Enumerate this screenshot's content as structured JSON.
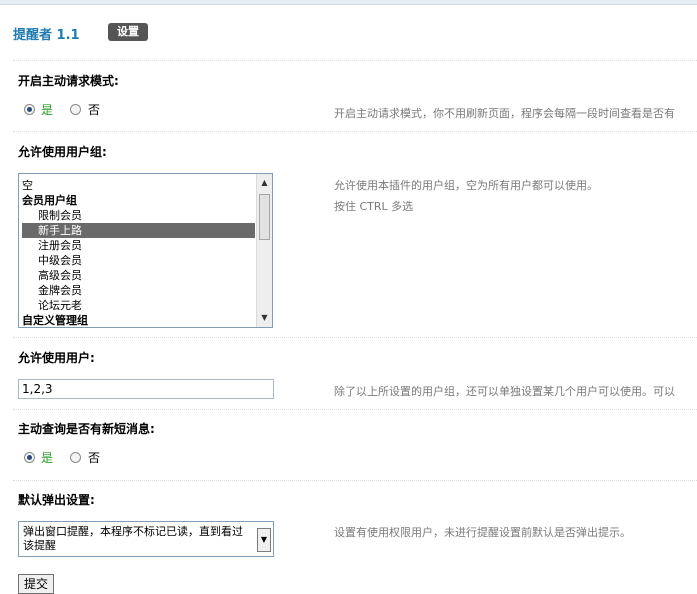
{
  "header": {
    "title": "提醒者 1.1",
    "settings_label": "设置"
  },
  "sections": {
    "active_mode": {
      "label": "开启主动请求模式:",
      "yes": "是",
      "no": "否",
      "selected": "yes",
      "desc": "开启主动请求模式，你不用刷新页面，程序会每隔一段时间查看是否有"
    },
    "allowed_groups": {
      "label": "允许使用用户组:",
      "desc_line1": "允许使用本插件的用户组，空为所有用户都可以使用。",
      "desc_line2": "按住 CTRL 多选",
      "options": [
        {
          "text": "空",
          "kind": "item",
          "selected": false
        },
        {
          "text": "会员用户组",
          "kind": "group",
          "selected": false
        },
        {
          "text": "限制会员",
          "kind": "child",
          "selected": false
        },
        {
          "text": "新手上路",
          "kind": "child",
          "selected": true
        },
        {
          "text": "注册会员",
          "kind": "child",
          "selected": false
        },
        {
          "text": "中级会员",
          "kind": "child",
          "selected": false
        },
        {
          "text": "高级会员",
          "kind": "child",
          "selected": false
        },
        {
          "text": "金牌会员",
          "kind": "child",
          "selected": false
        },
        {
          "text": "论坛元老",
          "kind": "child",
          "selected": false
        },
        {
          "text": "自定义管理组",
          "kind": "group",
          "selected": false
        }
      ]
    },
    "allowed_users": {
      "label": "允许使用用户:",
      "value": "1,2,3",
      "desc": "除了以上所设置的用户组，还可以单独设置某几个用户可以使用。可以"
    },
    "check_pm": {
      "label": "主动查询是否有新短消息:",
      "yes": "是",
      "no": "否",
      "selected": "yes"
    },
    "popup": {
      "label": "默认弹出设置:",
      "selected_value": "弹出窗口提醒，本程序不标记已读，直到看过该提醒",
      "desc": "设置有使用权限用户，未进行提醒设置前默认是否弹出提示。"
    }
  },
  "submit_label": "提交",
  "icons": {
    "scroll_up": "triangle-up-icon",
    "scroll_down": "triangle-down-icon",
    "dropdown": "chevron-down-icon"
  }
}
